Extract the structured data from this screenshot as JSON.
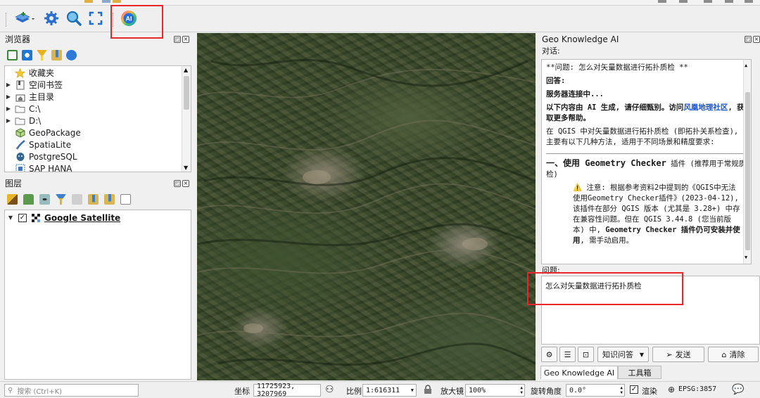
{
  "browser_panel": {
    "title": "浏览器",
    "items": [
      {
        "label": "收藏夹",
        "icon": "star-icon",
        "expandable": false
      },
      {
        "label": "空间书签",
        "icon": "bookmark-icon",
        "expandable": true
      },
      {
        "label": "主目录",
        "icon": "home-folder-icon",
        "expandable": true
      },
      {
        "label": "C:\\",
        "icon": "folder-icon",
        "expandable": true
      },
      {
        "label": "D:\\",
        "icon": "folder-icon",
        "expandable": true
      },
      {
        "label": "GeoPackage",
        "icon": "geopackage-icon",
        "expandable": false
      },
      {
        "label": "SpatiaLite",
        "icon": "spatialite-icon",
        "expandable": false
      },
      {
        "label": "PostgreSQL",
        "icon": "postgresql-icon",
        "expandable": false
      },
      {
        "label": "SAP HANA",
        "icon": "sap-hana-icon",
        "expandable": false
      }
    ]
  },
  "layers_panel": {
    "title": "图层",
    "layers": [
      {
        "label": "Google Satellite",
        "checked": true
      }
    ]
  },
  "ai_panel": {
    "title": "Geo Knowledge AI",
    "chat_label": "对话:",
    "question_label": "问题:",
    "chat": {
      "q_line": "**问题: 怎么对矢量数据进行拓扑质检 **",
      "answer_label": "回答:",
      "connecting": "服务器连接中...",
      "disclaimer_pre": "以下内容由 AI 生成, 请仔细甄别。访问",
      "disclaimer_link": "风凰地理社区",
      "disclaimer_post": ", 获取更多帮助。",
      "intro": "在 QGIS 中对矢量数据进行拓扑质检 (即拓扑关系检查), 主要有以下几种方法, 适用于不同场景和精度要求:",
      "section_title": "一、使用 Geometry Checker",
      "section_suffix": " 插件 (推荐用于常规质检)",
      "note_pre": "⚠️ 注意: 根据参考资料2中提到的《QGIS中无法使用Geometry Checker插件》(2023-04-12), 该插件在部分 QGIS 版本 (尤其是 3.28+) 中存在兼容性问题。但在 QGIS 3.44.8 (您当前版本) 中, ",
      "note_bold": "Geometry Checker 插件仍可安装并使用",
      "note_post": ", 需手动启用。"
    },
    "question_text": "怎么对矢量数据进行拓扑质检",
    "mode_select": "知识问答",
    "send_label": "发送",
    "clear_label": "清除",
    "tabs": [
      "Geo Knowledge AI",
      "工具箱"
    ],
    "active_tab": 0
  },
  "statusbar": {
    "search_placeholder": "搜索 (Ctrl+K)",
    "coord_label": "坐标",
    "coord_value": "11725923, 3207969",
    "scale_label": "比例",
    "scale_value": "1:616311",
    "magnifier_label": "放大镜",
    "magnifier_value": "100%",
    "rotation_label": "旋转角度",
    "rotation_value": "0.0°",
    "render_label": "渲染",
    "crs_label": "EPSG:3857"
  },
  "colors": {
    "highlight": "#e8262c",
    "link": "#1a55d6",
    "map_base": "#3e4f2e"
  }
}
